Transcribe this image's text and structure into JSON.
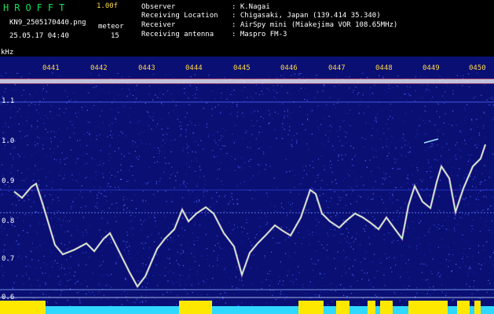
{
  "header": {
    "app_name": "HROFFT",
    "version": "1.00f",
    "filename": "KN9_2505170440.png",
    "meteor_label": "meteor",
    "meteor_count": "15",
    "datetime": "25.05.17 04:40",
    "fields": [
      {
        "label": "Observer",
        "value": ": K.Nagai"
      },
      {
        "label": "Receiving Location",
        "value": ": Chigasaki, Japan (139.414 35.340)"
      },
      {
        "label": "Receiver",
        "value": ": AirSpy mini (Miakejima VOR 108.65MHz)"
      },
      {
        "label": "Receiving antenna",
        "value": ": Maspro FM-3"
      }
    ]
  },
  "spectrogram": {
    "unit_label": "kHz",
    "y_ticks": [
      "1.1",
      "1.0",
      "0.9",
      "0.8",
      "0.7",
      "0.6"
    ],
    "time_labels": [
      "0441",
      "0442",
      "0443",
      "0444",
      "0445",
      "0446",
      "0447",
      "0448",
      "0449",
      "0450"
    ],
    "colors": {
      "background": "#0a0f73",
      "trace": "#c8ffd0",
      "band": "#ffffff",
      "bottom_yellow": "#ffe800",
      "bottom_cyan": "#2fd8ff",
      "labels": "#ffd84a"
    }
  }
}
